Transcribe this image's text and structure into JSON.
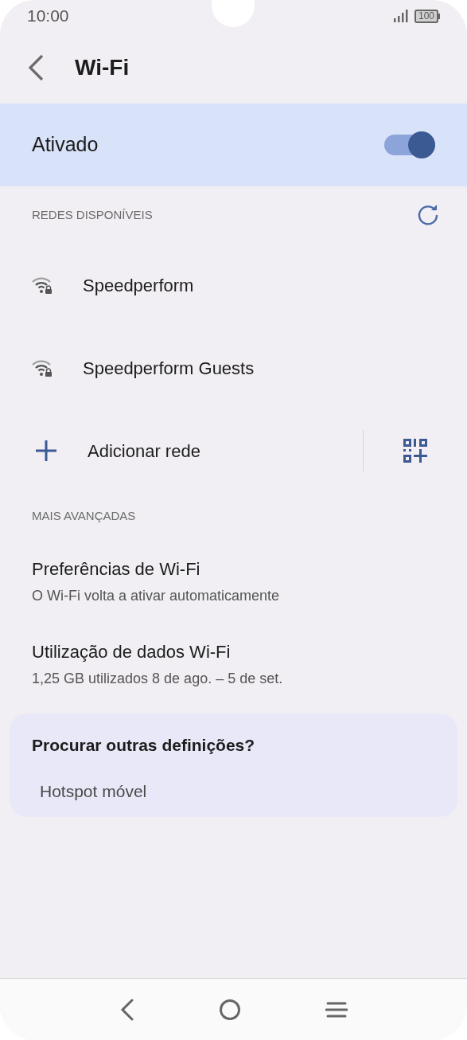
{
  "status_bar": {
    "time": "10:00",
    "battery": "100"
  },
  "header": {
    "title": "Wi-Fi"
  },
  "master_toggle": {
    "label": "Ativado",
    "on": true
  },
  "available_section": {
    "title": "REDES DISPONÍVEIS"
  },
  "networks": [
    {
      "name": "Speedperform"
    },
    {
      "name": "Speedperform Guests"
    }
  ],
  "add_network": {
    "label": "Adicionar rede"
  },
  "advanced_section": {
    "title": "MAIS AVANÇADAS"
  },
  "settings": [
    {
      "title": "Preferências de Wi-Fi",
      "subtitle": "O Wi-Fi volta a ativar automaticamente"
    },
    {
      "title": "Utilização de dados Wi-Fi",
      "subtitle": "1,25 GB utilizados 8 de ago. – 5 de set."
    }
  ],
  "suggestion_card": {
    "title": "Procurar outras definições?",
    "links": [
      "Hotspot móvel"
    ]
  }
}
